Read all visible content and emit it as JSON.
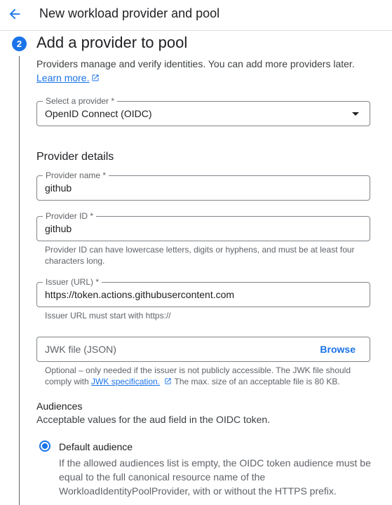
{
  "header": {
    "title": "New workload provider and pool",
    "back_icon": "arrow-back-icon"
  },
  "step": {
    "number": "2",
    "title": "Add a provider to pool",
    "description": "Providers manage and verify identities. You can add more providers later.",
    "learn_more": "Learn more."
  },
  "provider_select": {
    "label": "Select a provider *",
    "value": "OpenID Connect (OIDC)"
  },
  "provider_details": {
    "heading": "Provider details",
    "name": {
      "label": "Provider name *",
      "value": "github"
    },
    "id": {
      "label": "Provider ID *",
      "value": "github",
      "hint_line1": "Provider ID can have lowercase letters, digits or hyphens, and must be at least four",
      "hint_line2": "characters long."
    },
    "issuer": {
      "label": "Issuer (URL) *",
      "value": "https://token.actions.githubusercontent.com",
      "hint": "Issuer URL must start with https://"
    },
    "jwk": {
      "placeholder": "JWK file (JSON)",
      "browse": "Browse",
      "hint_line1": "Optional – only needed if the issuer is not publicly accessible. The JWK file should",
      "hint_prefix": "comply with",
      "hint_link": "JWK specification.",
      "hint_suffix": "The max. size of an acceptable file is 80 KB."
    }
  },
  "audiences": {
    "title": "Audiences",
    "description": "Acceptable values for the aud field in the OIDC token.",
    "default_label": "Default audience",
    "default_desc": "If the allowed audiences list is empty, the OIDC token audience must be equal to the full canonical resource name of the WorkloadIdentityPoolProvider, with or without the HTTPS prefix."
  },
  "colors": {
    "accent": "#1a73e8",
    "text": "#202124",
    "muted": "#5f6368",
    "border": "#80868b"
  }
}
